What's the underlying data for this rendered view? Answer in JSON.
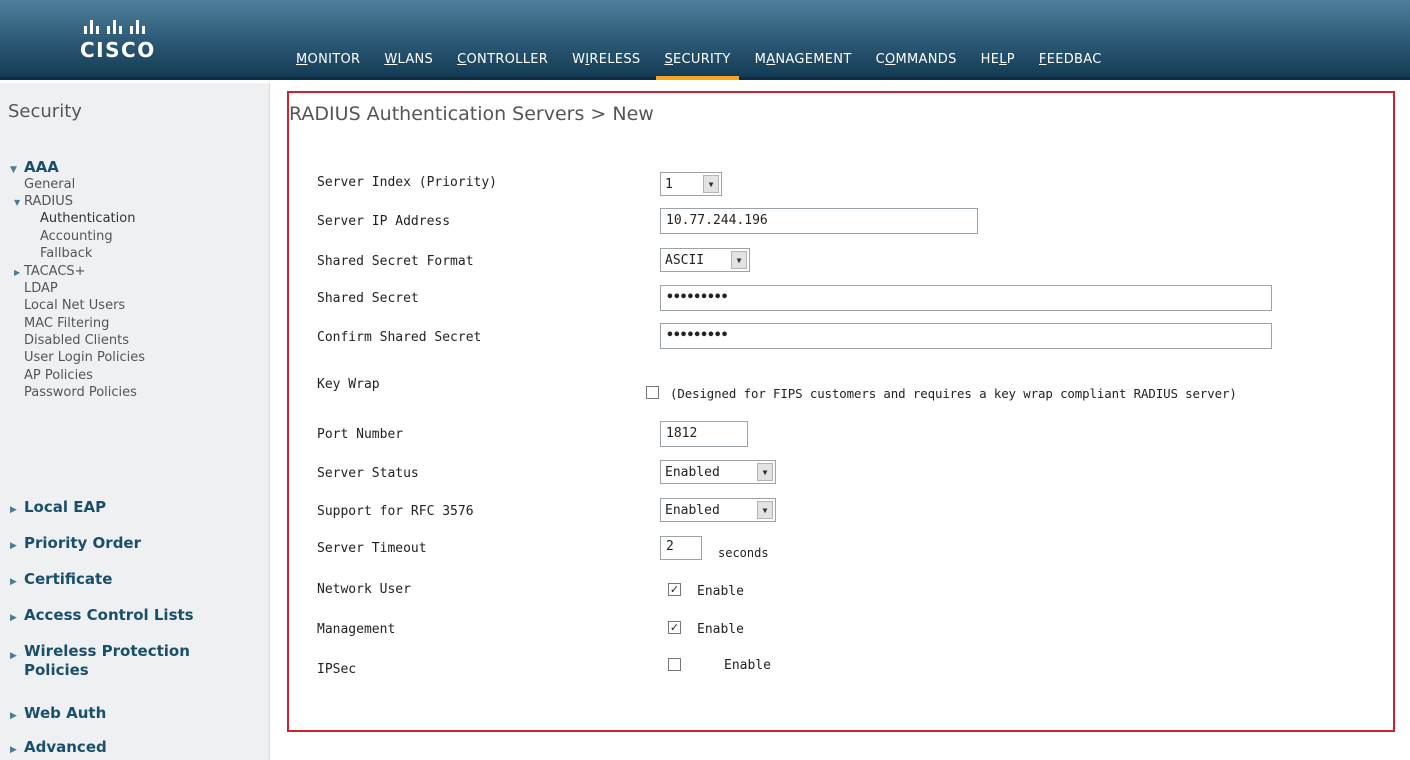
{
  "brand": {
    "name": "CISCO"
  },
  "nav": [
    {
      "pre": "",
      "ul": "M",
      "post": "ONITOR"
    },
    {
      "pre": "",
      "ul": "W",
      "post": "LANs"
    },
    {
      "pre": "",
      "ul": "C",
      "post": "ONTROLLER"
    },
    {
      "pre": "W",
      "ul": "I",
      "post": "RELESS"
    },
    {
      "pre": "",
      "ul": "S",
      "post": "ECURITY"
    },
    {
      "pre": "M",
      "ul": "A",
      "post": "NAGEMENT"
    },
    {
      "pre": "C",
      "ul": "O",
      "post": "MMANDS"
    },
    {
      "pre": "HE",
      "ul": "L",
      "post": "P"
    },
    {
      "pre": "",
      "ul": "F",
      "post": "EEDBAC"
    }
  ],
  "sidebar": {
    "title": "Security",
    "aaa": "AAA",
    "general": "General",
    "radius": "RADIUS",
    "authentication": "Authentication",
    "accounting": "Accounting",
    "fallback": "Fallback",
    "tacacs": "TACACS+",
    "ldap": "LDAP",
    "local_net_users": "Local Net Users",
    "mac_filtering": "MAC Filtering",
    "disabled_clients": "Disabled Clients",
    "user_login_policies": "User Login Policies",
    "ap_policies": "AP Policies",
    "password_policies": "Password Policies",
    "local_eap": "Local EAP",
    "priority_order": "Priority Order",
    "certificate": "Certificate",
    "acl": "Access Control Lists",
    "wireless_protection_1": "Wireless Protection",
    "wireless_protection_2": "Policies",
    "web_auth": "Web Auth",
    "advanced": "Advanced"
  },
  "page": {
    "title": "RADIUS Authentication Servers > New"
  },
  "form": {
    "server_index_label": "Server Index (Priority)",
    "server_index_value": "1",
    "server_ip_label": "Server IP Address",
    "server_ip_value": "10.77.244.196",
    "secret_format_label": "Shared Secret Format",
    "secret_format_value": "ASCII",
    "shared_secret_label": "Shared Secret",
    "shared_secret_value": "•••••••••",
    "confirm_secret_label": "Confirm Shared Secret",
    "confirm_secret_value": "•••••••••",
    "key_wrap_label": "Key Wrap",
    "key_wrap_note": "(Designed for FIPS customers and requires a key wrap compliant RADIUS server)",
    "port_label": "Port Number",
    "port_value": "1812",
    "server_status_label": "Server Status",
    "server_status_value": "Enabled",
    "rfc_label": "Support for RFC 3576",
    "rfc_value": "Enabled",
    "timeout_label": "Server Timeout",
    "timeout_value": "2",
    "timeout_unit": "seconds",
    "network_user_label": "Network User",
    "network_user_check": "✓",
    "network_user_enable": "Enable",
    "management_label": "Management",
    "management_check": "✓",
    "management_enable": "Enable",
    "ipsec_label": "IPSec",
    "ipsec_enable": "Enable"
  },
  "colors": {
    "accent": "#f5a623",
    "frame": "#d11f2b",
    "sidebar_heading": "#1a4f6b"
  }
}
